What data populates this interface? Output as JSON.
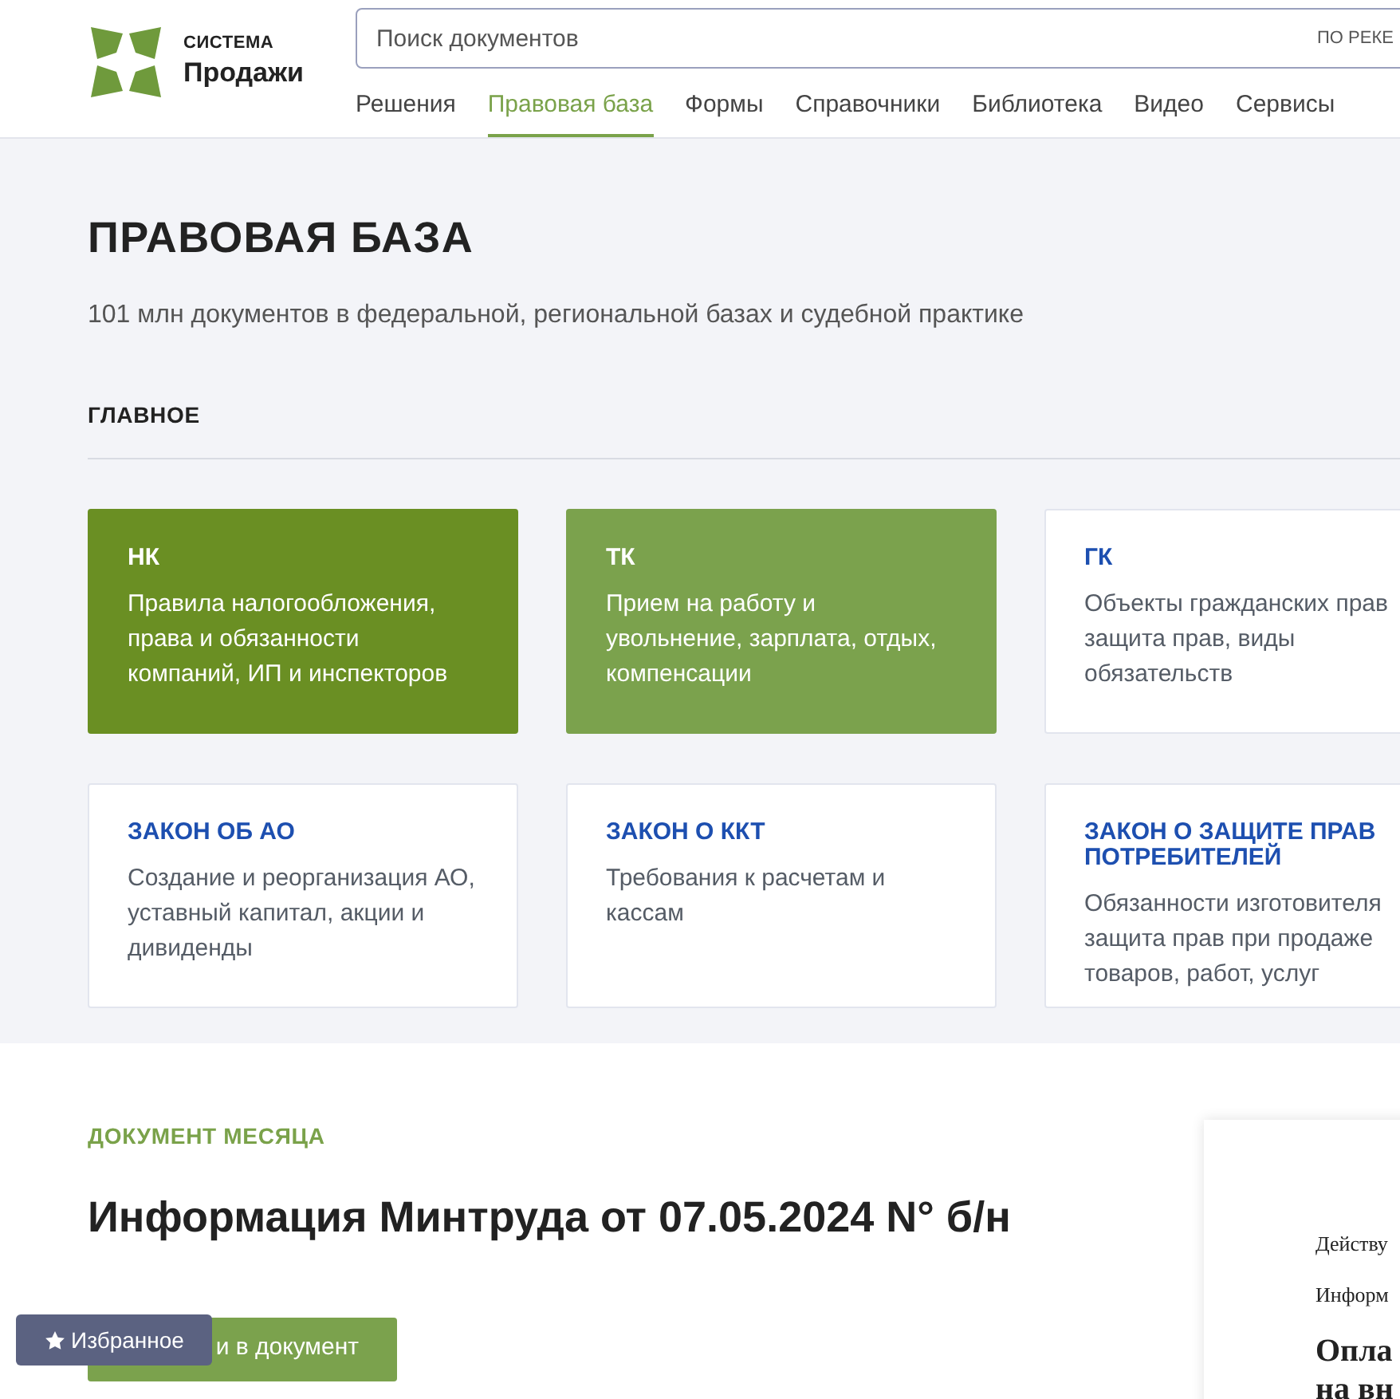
{
  "logo": {
    "line_1": "СИСТЕМА",
    "line_2": "Продажи"
  },
  "search": {
    "placeholder": "Поиск документов",
    "scope": "ПО РЕКЕ"
  },
  "nav": [
    {
      "label": "Решения",
      "selected": false
    },
    {
      "label": "Правовая база",
      "selected": true
    },
    {
      "label": "Формы",
      "selected": false
    },
    {
      "label": "Справочники",
      "selected": false
    },
    {
      "label": "Библиотека",
      "selected": false
    },
    {
      "label": "Видео",
      "selected": false
    },
    {
      "label": "Сервисы",
      "selected": false
    }
  ],
  "hero": {
    "title": "ПРАВОВАЯ БАЗА",
    "subtitle": "101 млн документов в федеральной, региональной базах и судебной практике",
    "section": "ГЛАВНОЕ"
  },
  "cards": [
    {
      "kind": "dark",
      "title": "НК",
      "text": "Правила налогообложения, права и обязанности компаний, ИП и инспекторов"
    },
    {
      "kind": "light",
      "title": "ТК",
      "text": "Прием на работу и увольнение, зарплата, отдых, компенсации"
    },
    {
      "kind": "plain",
      "title": "ГК",
      "text": "Объекты гражданских прав защита прав, виды обязательств"
    },
    {
      "kind": "plain",
      "title": "ЗАКОН ОБ АО",
      "text": "Создание и реорганизация АО, уставный капитал, акции и дивиденды"
    },
    {
      "kind": "plain",
      "title": "ЗАКОН О ККТ",
      "text": "Требования к расчетам и кассам"
    },
    {
      "kind": "plain",
      "title": "ЗАКОН О ЗАЩИТЕ ПРАВ ПОТРЕБИТЕЛЕЙ",
      "text": "Обязанности изготовителя защита прав при продаже товаров, работ, услуг"
    }
  ],
  "document_of_month": {
    "label": "ДОКУМЕНТ МЕСЯЦА",
    "title": "Информация Минтруда от 07.05.2024 N° б/н",
    "button": "и в документ",
    "preview": {
      "line_1": "Действу",
      "line_2": "Информ",
      "heading_1": "Опла",
      "heading_2": "на вн"
    }
  },
  "favorites": {
    "label": "Избранное"
  }
}
